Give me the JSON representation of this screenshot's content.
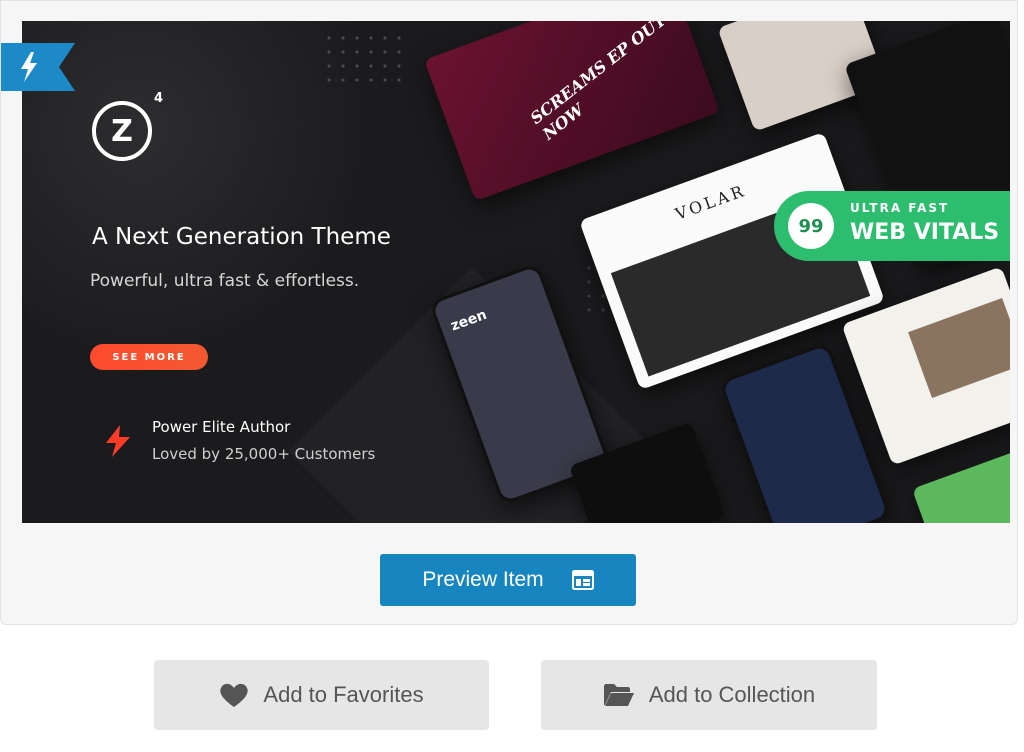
{
  "banner": {
    "logo_letter": "Z",
    "logo_superscript": "4",
    "headline": "A Next Generation Theme",
    "subline": "Powerful, ultra fast & effortless.",
    "cta": "SEE MORE",
    "author_title": "Power Elite Author",
    "author_subtitle": "Loved by 25,000+ Customers",
    "vitals_score": "99",
    "vitals_line1": "ULTRA FAST",
    "vitals_line2": "WEB VITALS",
    "mockup_red_text": "SCREAMS EP OUT NOW",
    "mockup_laptop_title": "VOLAR",
    "mockup_phone_title": "zeen",
    "colors": {
      "accent_orange": "#ff4b2f",
      "vitals_green": "#2dbd6e",
      "flag_blue": "#1c8ac6"
    }
  },
  "actions": {
    "preview_label": "Preview Item",
    "favorites_label": "Add to Favorites",
    "collection_label": "Add to Collection",
    "preview_color": "#1785c0"
  },
  "icons": {
    "flag": "lightning-bolt-icon",
    "preview": "layout-preview-icon",
    "favorites": "heart-icon",
    "collection": "folder-open-icon"
  }
}
